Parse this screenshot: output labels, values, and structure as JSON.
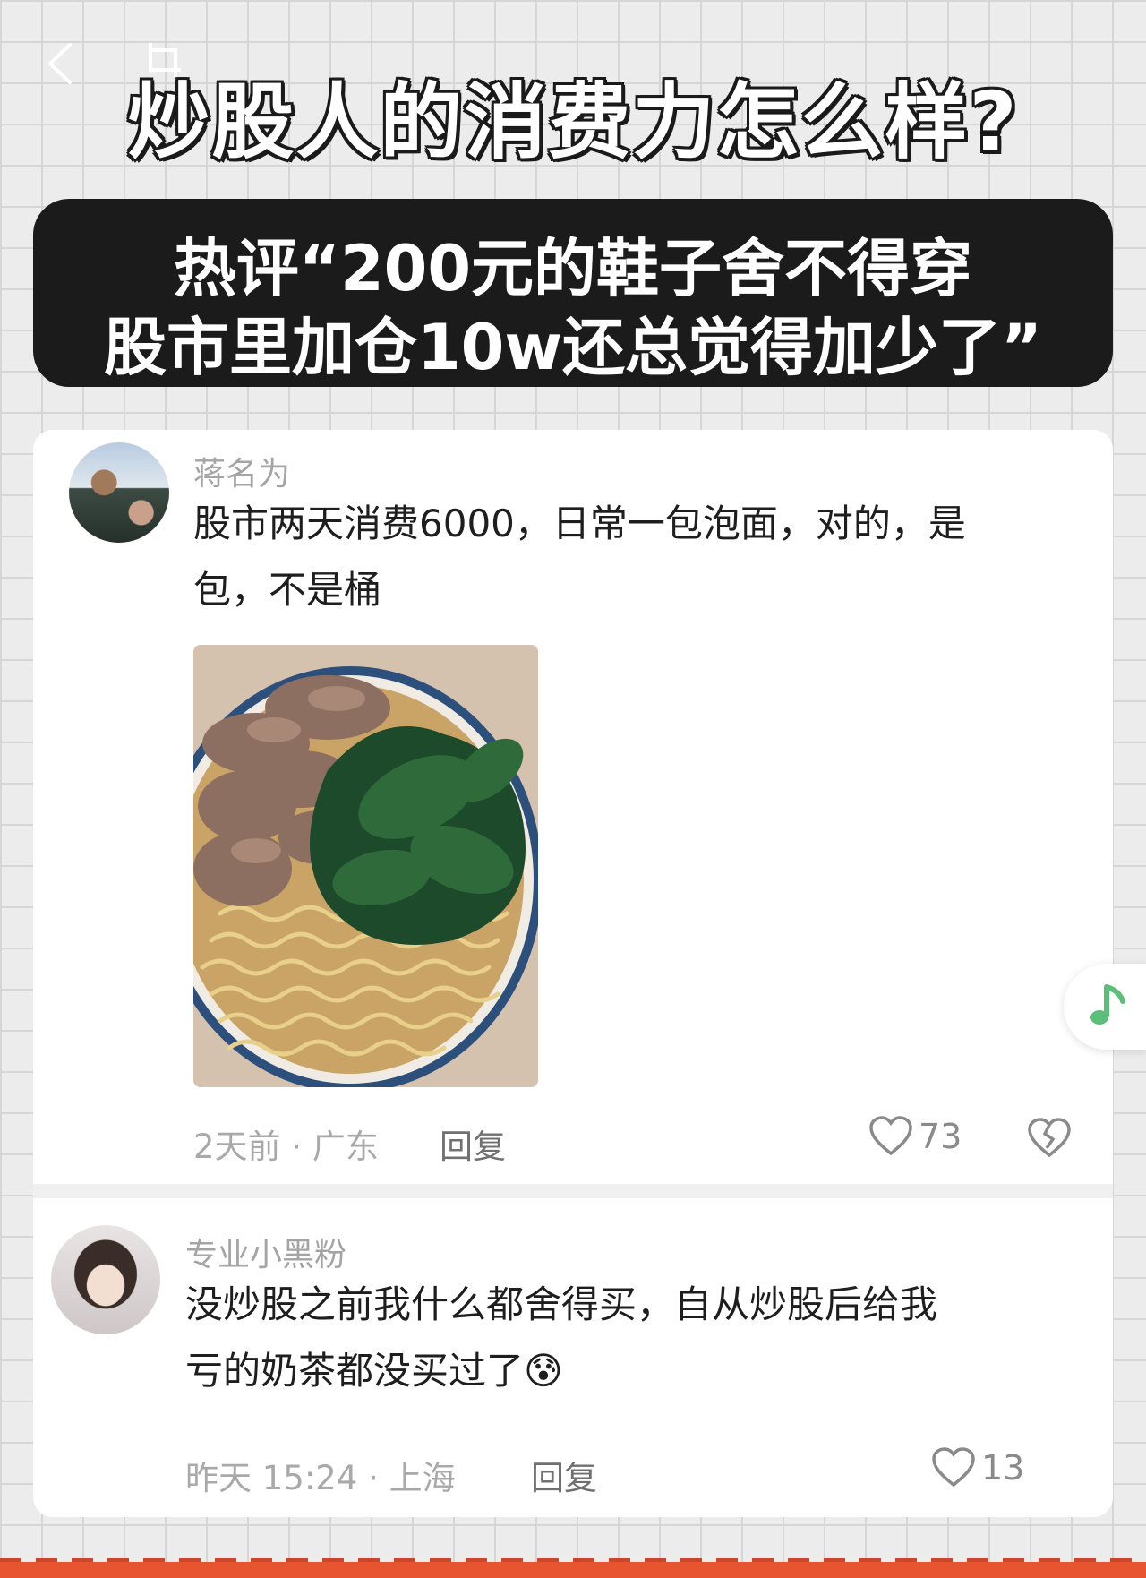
{
  "header": {
    "title": "炒股人的消费力怎么样?",
    "quote_line1": "热评“200元的鞋子舍不得穿",
    "quote_line2": "股市里加仓10w还总觉得加少了”"
  },
  "comments": [
    {
      "username": "蒋名为",
      "text_line1": "股市两天消费6000，日常一包泡面，对的，是",
      "text_line2": "包，不是桶",
      "meta": "2天前 · 广东",
      "reply_label": "回复",
      "like_count": "73"
    },
    {
      "username": "专业小黑粉",
      "text_line1": "没炒股之前我什么都舍得买，自从炒股后给我",
      "text_line2": "亏的奶茶都没买过了",
      "emoji": "😰",
      "meta": "昨天 15:24 · 上海",
      "reply_label": "回复",
      "like_count": "13"
    }
  ],
  "icons": {
    "back": "back-arrow-icon",
    "crop": "crop-icon",
    "like": "heart-icon",
    "dislike": "broken-heart-icon",
    "music": "music-note-icon"
  },
  "colors": {
    "accent_bar": "#e8542f",
    "music_note": "#5bbf7a",
    "quote_box": "#1b1b1b"
  }
}
